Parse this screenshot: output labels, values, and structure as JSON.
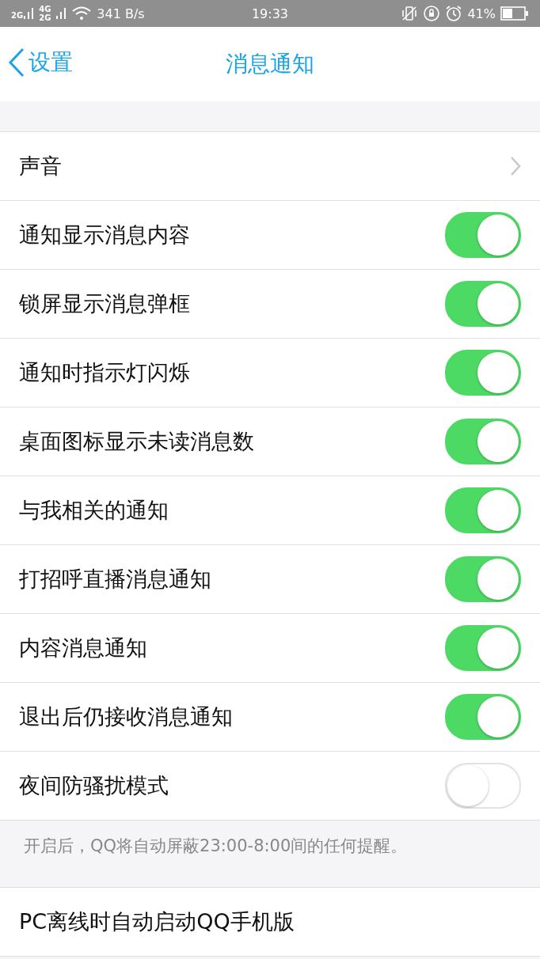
{
  "status_bar": {
    "sim1": "2G",
    "sim2_top": "4G",
    "sim2_bottom": "2G",
    "speed": "341 B/s",
    "time": "19:33",
    "battery": "41%"
  },
  "nav": {
    "back": "设置",
    "title": "消息通知"
  },
  "rows": [
    {
      "kind": "link",
      "label": "声音"
    },
    {
      "kind": "toggle",
      "label": "通知显示消息内容",
      "on": true
    },
    {
      "kind": "toggle",
      "label": "锁屏显示消息弹框",
      "on": true
    },
    {
      "kind": "toggle",
      "label": "通知时指示灯闪烁",
      "on": true
    },
    {
      "kind": "toggle",
      "label": "桌面图标显示未读消息数",
      "on": true
    },
    {
      "kind": "toggle",
      "label": "与我相关的通知",
      "on": true
    },
    {
      "kind": "toggle",
      "label": "打招呼直播消息通知",
      "on": true
    },
    {
      "kind": "toggle",
      "label": "内容消息通知",
      "on": true
    },
    {
      "kind": "toggle",
      "label": "退出后仍接收消息通知",
      "on": true
    },
    {
      "kind": "toggle",
      "label": "夜间防骚扰模式",
      "on": false
    }
  ],
  "note": "开启后，QQ将自动屏蔽23:00-8:00间的任何提醒。",
  "rows2": [
    {
      "label": "PC离线时自动启动QQ手机版"
    }
  ]
}
